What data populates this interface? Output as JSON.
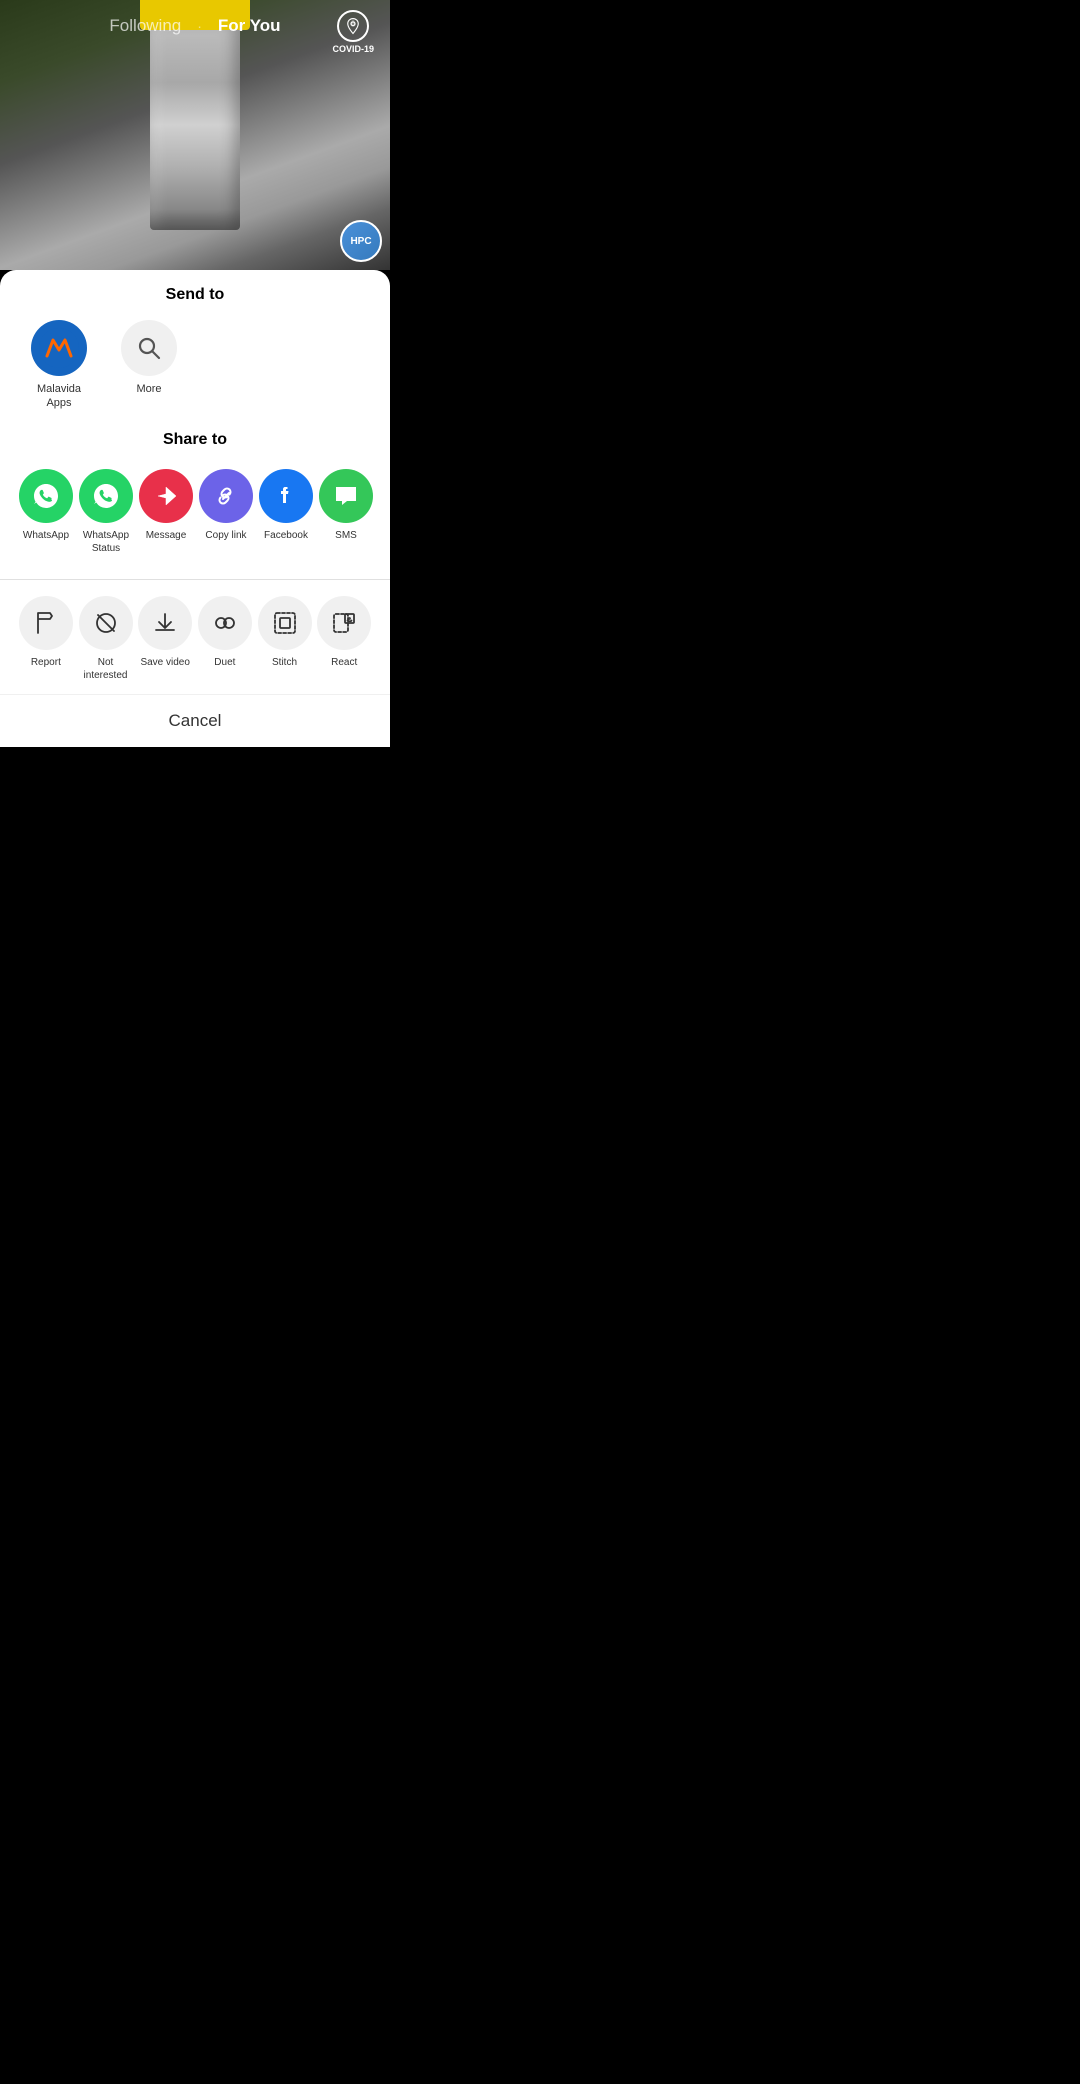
{
  "nav": {
    "following_label": "Following",
    "for_you_label": "For You",
    "covid_label": "COVID-19",
    "divider": "·"
  },
  "send_to": {
    "title": "Send to",
    "contacts": [
      {
        "name": "Malavida\nApps",
        "type": "avatar"
      },
      {
        "name": "More",
        "type": "search"
      }
    ]
  },
  "share_to": {
    "title": "Share to",
    "items": [
      {
        "name": "WhatsApp",
        "color": "whatsapp-green",
        "icon": "whatsapp"
      },
      {
        "name": "WhatsApp\nStatus",
        "color": "whatsapp-green",
        "icon": "whatsapp"
      },
      {
        "name": "Message",
        "color": "message-red",
        "icon": "message"
      },
      {
        "name": "Copy link",
        "color": "copy-purple",
        "icon": "link"
      },
      {
        "name": "Facebook",
        "color": "facebook-blue",
        "icon": "facebook"
      },
      {
        "name": "SMS",
        "color": "sms-green",
        "icon": "sms"
      }
    ]
  },
  "actions": {
    "items": [
      {
        "name": "Report",
        "icon": "flag"
      },
      {
        "name": "Not\ninterested",
        "icon": "ban"
      },
      {
        "name": "Save video",
        "icon": "download"
      },
      {
        "name": "Duet",
        "icon": "duet"
      },
      {
        "name": "Stitch",
        "icon": "stitch"
      },
      {
        "name": "React",
        "icon": "react"
      }
    ]
  },
  "cancel": {
    "label": "Cancel"
  }
}
